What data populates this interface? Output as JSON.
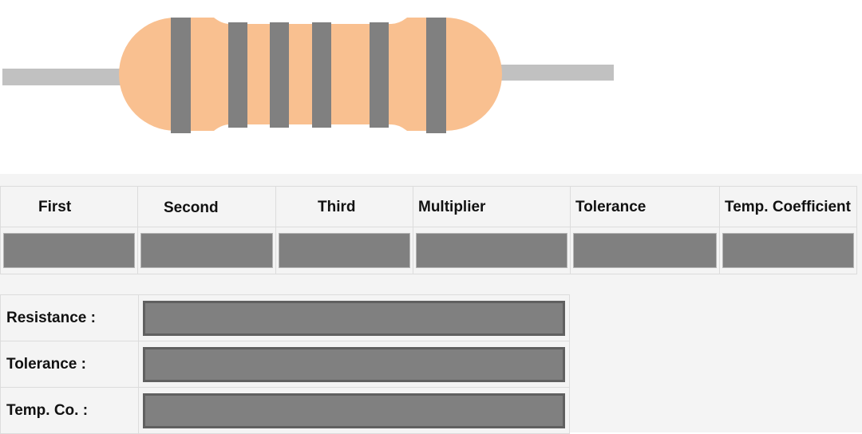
{
  "colors": {
    "resistor_body": "#f9c090",
    "band": "#808080",
    "lead": "#c1c1c1",
    "panel_bg": "#f4f4f4",
    "field": "#808080"
  },
  "band_table": {
    "headers": [
      "First",
      "Second",
      "Third",
      "Multiplier",
      "Tolerance",
      "Temp. Coefficient"
    ]
  },
  "results": {
    "resistance_label": "Resistance :",
    "tolerance_label": "Tolerance :",
    "temp_co_label": "Temp. Co. :"
  }
}
